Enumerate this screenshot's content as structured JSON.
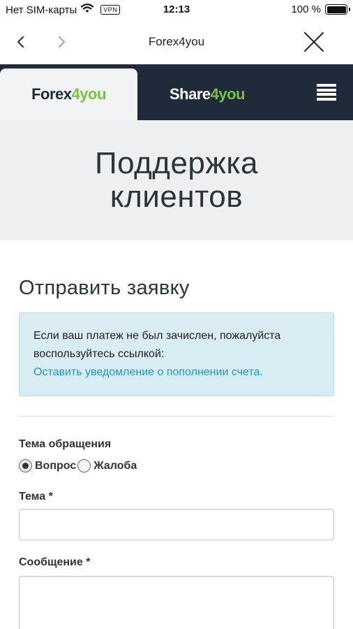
{
  "status_bar": {
    "carrier": "Нет SIM-карты",
    "vpn": "VPN",
    "time": "12:13",
    "battery": "100 %",
    "wifi_icon": "wifi-icon",
    "battery_icon": "battery-icon",
    "battery_level": 1.0
  },
  "browser_nav": {
    "title": "Forex4you",
    "back_icon": "chevron-left-icon",
    "forward_icon": "chevron-right-icon",
    "close_icon": "close-icon"
  },
  "site_header": {
    "tabs": [
      {
        "logo_main": "Forex",
        "logo_accent": "4you",
        "active": true
      },
      {
        "logo_main": "Share",
        "logo_accent": "4you",
        "active": false
      }
    ],
    "menu_icon": "hamburger-menu-icon",
    "colors": {
      "background": "#1f2b3a",
      "accent": "#7cc242",
      "active_tab": "#f2f3f4"
    }
  },
  "hero": {
    "title": "Поддержка клиентов"
  },
  "form": {
    "section_title": "Отправить заявку",
    "info": {
      "text": "Если ваш платеж не был зачислен, пожалуйста воспользуйтесь ссылкой:",
      "link": "Оставить уведомление о пополнении счета."
    },
    "topic_type_label": "Тема обращения",
    "topic_options": [
      {
        "label": "Вопрос",
        "checked": true
      },
      {
        "label": "Жалоба",
        "checked": false
      }
    ],
    "subject_label": "Тема *",
    "subject_value": "",
    "message_label": "Сообщение *",
    "message_value": ""
  }
}
